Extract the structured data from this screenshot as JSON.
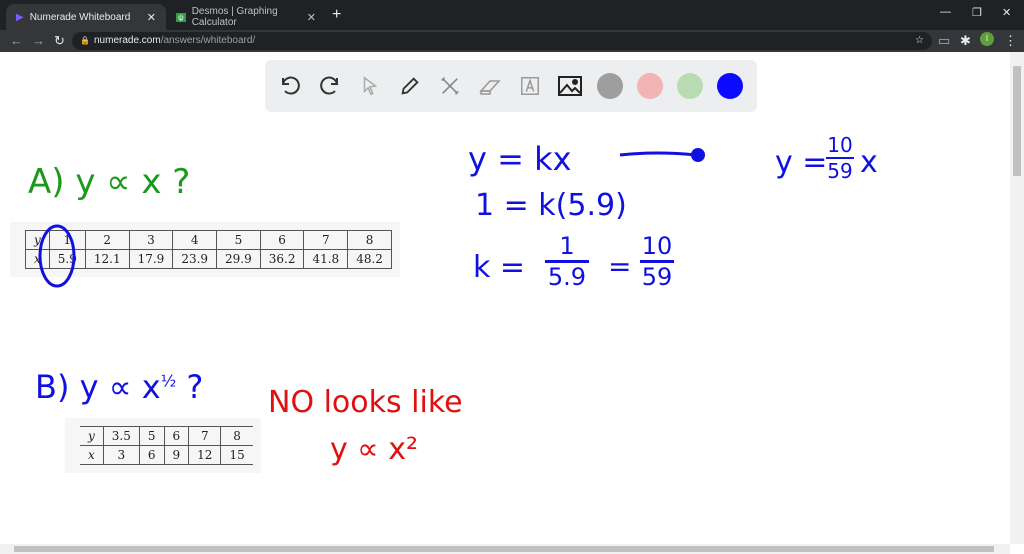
{
  "browser": {
    "tabs": [
      {
        "title": "Numerade Whiteboard",
        "active": true
      },
      {
        "title": "Desmos | Graphing Calculator",
        "active": false
      }
    ],
    "url_host": "numerade.com",
    "url_path": "/answers/whiteboard/",
    "profile_initial": "I"
  },
  "toolbar": {
    "tools": [
      "undo-icon",
      "redo-icon",
      "pointer-icon",
      "pen-icon",
      "tools-icon",
      "eraser-icon",
      "text-icon",
      "image-icon"
    ],
    "colors": [
      "#9e9e9e",
      "#f2b3b5",
      "#b8dbb2",
      "#0a0aff"
    ]
  },
  "partA": {
    "label": "A)  y ∝ x ?",
    "table": {
      "y_label": "y",
      "x_label": "x",
      "y": [
        "1",
        "2",
        "3",
        "4",
        "5",
        "6",
        "7",
        "8"
      ],
      "x": [
        "5.9",
        "12.1",
        "17.9",
        "23.9",
        "29.9",
        "36.2",
        "41.8",
        "48.2"
      ]
    }
  },
  "partB": {
    "label": "B)  y ∝ x",
    "exp": "½",
    "q": "?",
    "table": {
      "y_label": "y",
      "x_label": "x",
      "y": [
        "3.5",
        "5",
        "6",
        "7",
        "8"
      ],
      "x": [
        "3",
        "6",
        "9",
        "12",
        "15"
      ]
    }
  },
  "notes": {
    "red1": "NO  looks  like",
    "red2": "y ∝ x²",
    "eq1": "y = kx",
    "eq2": "1 = k(5.9)",
    "eq3a": "k =",
    "eq3num": "1",
    "eq3den": "5.9",
    "eq3eq": "=",
    "eq3num2": "10",
    "eq3den2": "59",
    "res_a": "y =",
    "res_num": "10",
    "res_den": "59",
    "res_x": "x"
  }
}
